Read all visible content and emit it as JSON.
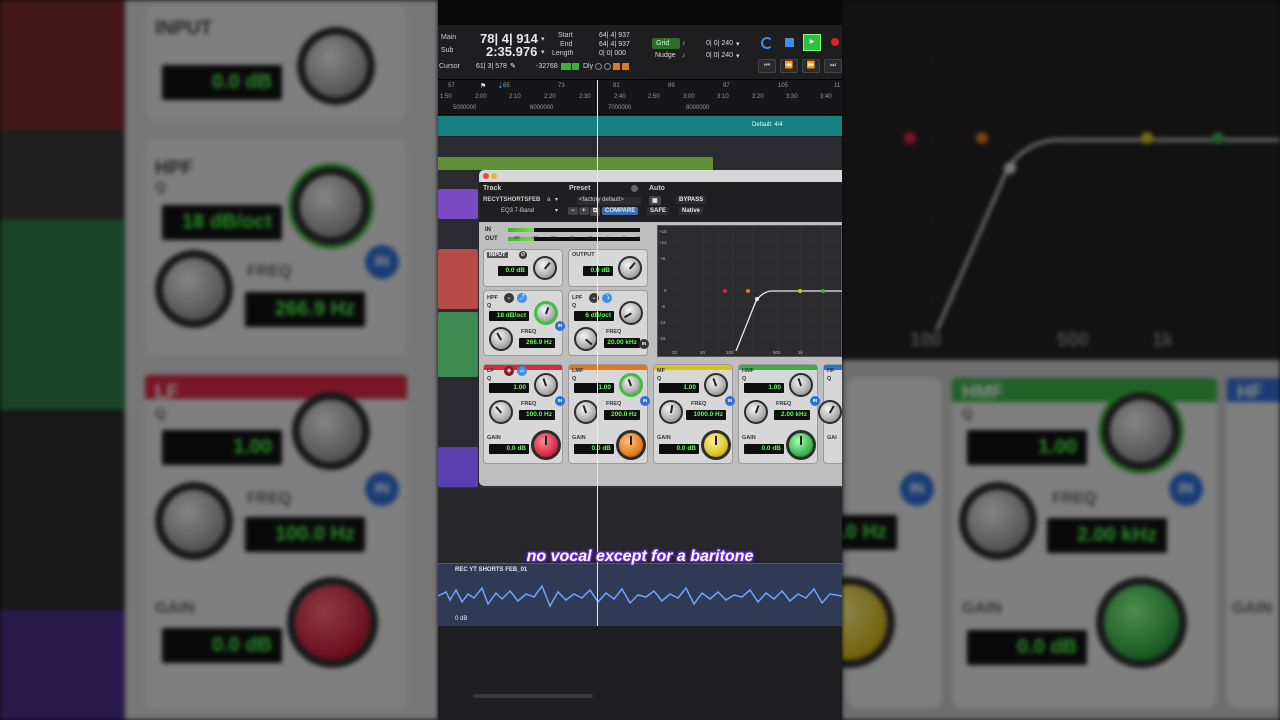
{
  "transport": {
    "main_label": "Main",
    "sub_label": "Sub",
    "main_counter": "78| 4| 914",
    "sub_counter": "2:35.976",
    "start_label": "Start",
    "end_label": "End",
    "length_label": "Length",
    "start_val": "64| 4| 937",
    "end_val": "64| 4| 937",
    "length_val": "0| 0| 000",
    "cursor_label": "Cursor",
    "cursor_val": "61| 3| 578",
    "cursor_num": "-32768",
    "dly_label": "Dly",
    "grid_label": "Grid",
    "grid_val": "0| 0| 240",
    "nudge_label": "Nudge",
    "nudge_val": "0| 0| 240"
  },
  "ruler": {
    "bars": [
      "57",
      "65",
      "73",
      "81",
      "89",
      "97",
      "105",
      "11"
    ],
    "times": [
      "1:50",
      "2:00",
      "2:10",
      "2:20",
      "2:30",
      "2:40",
      "2:50",
      "3:00",
      "3:10",
      "3:20",
      "3:30",
      "3:40"
    ],
    "samples": [
      "5000000",
      "6000000",
      "7000000",
      "8000000"
    ],
    "meter_label": "Default: 4/4"
  },
  "plugin": {
    "track_header": "Track",
    "preset_header": "Preset",
    "auto_header": "Auto",
    "track_name": "RECYTSHORTSFEB",
    "track_suffix": "a",
    "plugin_name": "EQ3 7-Band",
    "preset_name": "<factory default>",
    "compare_label": "COMPARE",
    "bypass_label": "BYPASS",
    "safe_label": "SAFE",
    "native_label": "Native",
    "meter_in": "IN",
    "meter_out": "OUT",
    "meter_ticks": [
      "-60",
      "-32",
      "-22",
      "-16",
      "-10",
      "-6",
      "-3",
      "0"
    ],
    "input": {
      "label": "INPUT",
      "value": "0.0 dB"
    },
    "output": {
      "label": "OUTPUT",
      "value": "0.0 dB"
    },
    "hpf": {
      "label": "HPF",
      "q_label": "Q",
      "q_value": "18 dB/oct",
      "freq_label": "FREQ",
      "freq_value": "266.9 Hz"
    },
    "lpf": {
      "label": "LPF",
      "q_label": "Q",
      "q_value": "6 dB/oct",
      "freq_label": "FREQ",
      "freq_value": "20.00 kHz"
    },
    "bands": [
      {
        "label": "LF",
        "q_label": "Q",
        "q": "1.00",
        "freq_label": "FREQ",
        "freq": "100.0 Hz",
        "gain_label": "GAIN",
        "gain": "0.0 dB",
        "color": "#d62a45"
      },
      {
        "label": "LMF",
        "q_label": "Q",
        "q": "1.00",
        "freq_label": "FREQ",
        "freq": "200.0 Hz",
        "gain_label": "GAIN",
        "gain": "0.0 dB",
        "color": "#e07a1e"
      },
      {
        "label": "MF",
        "q_label": "Q",
        "q": "1.00",
        "freq_label": "FREQ",
        "freq": "1000.0 Hz",
        "gain_label": "GAIN",
        "gain": "0.0 dB",
        "color": "#d8c21e"
      },
      {
        "label": "HMF",
        "q_label": "Q",
        "q": "1.00",
        "freq_label": "FREQ",
        "freq": "2.00 kHz",
        "gain_label": "GAIN",
        "gain": "0.0 dB",
        "color": "#3ab04a"
      },
      {
        "label": "HF",
        "q_label": "Q",
        "q": "",
        "freq_label": "",
        "freq": "",
        "gain_label": "GAI",
        "gain": "",
        "color": "#2f6fd6"
      }
    ],
    "in_label": "IN",
    "graph_y": [
      "+18",
      "+12",
      "+6",
      "0",
      "-6",
      "-12",
      "-18"
    ],
    "graph_x": [
      "20",
      "50",
      "100",
      "500",
      "1k"
    ]
  },
  "blurred": {
    "input_label": "INPUT",
    "input_value": "0.0 dB",
    "hpf_label": "HPF",
    "q_label": "Q",
    "hpf_q": "18 dB/oct",
    "freq_label": "FREQ",
    "hpf_freq": "266.9 Hz",
    "lf_label": "LF",
    "lf_q": "1.00",
    "lf_freq": "100.0 Hz",
    "gain_label": "GAIN",
    "lf_gain": "0.0 dB",
    "in_label": "IN",
    "graph_x": [
      "100",
      "500",
      "1k"
    ],
    "hmf_label": "HMF",
    "hmf_q": "1.00",
    "hmf_freq": "2.00 kHz",
    "hmf_gain": "0.0 dB",
    "hz_frag": ".0 Hz",
    "hf_label": "HF",
    "gai_label": "GAIN"
  },
  "bottom_track": {
    "name": "REC YT SHORTS FEB_01",
    "volume": "0 dB"
  },
  "subtitle": "no vocal except for a baritone"
}
